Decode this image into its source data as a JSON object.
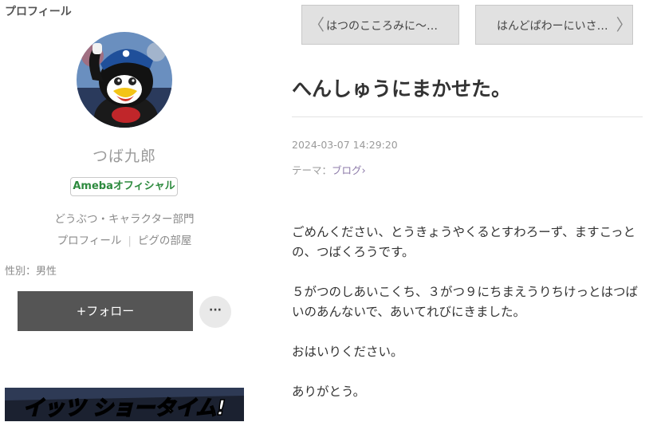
{
  "sidebar": {
    "heading": "プロフィール",
    "name": "つば九郎",
    "badge": "Amebaオフィシャル",
    "category": "どうぶつ・キャラクター部門",
    "links": [
      "プロフィール",
      "ピグの部屋"
    ],
    "gender": "性別：男性",
    "follow_label": "+フォロー",
    "more_label": "···",
    "banner_text": "イッツ ショータイム!"
  },
  "nav": {
    "prev_label": "はつのこころみに～…",
    "next_label": "はんどぱわーにいさ…"
  },
  "entry": {
    "title": "へんしゅうにまかせた。",
    "date": "2024-03-07 14:29:20",
    "theme_prefix": "テーマ：",
    "theme": "ブログ",
    "paragraphs": [
      "ごめんください、とうきょうやくるとすわろーず、ますこっとの、つばくろうです。",
      "５がつのしあいこくち、３がつ９にちまえうりちけっとはつばいのあんないで、あいてれびにきました。",
      "おはいりください。",
      "ありがとう。"
    ]
  },
  "colors": {
    "follow_button": "#555555",
    "official_text": "#2d8a3e",
    "theme_link": "#8c7aa8",
    "nav_button": "#e1e1e1"
  }
}
